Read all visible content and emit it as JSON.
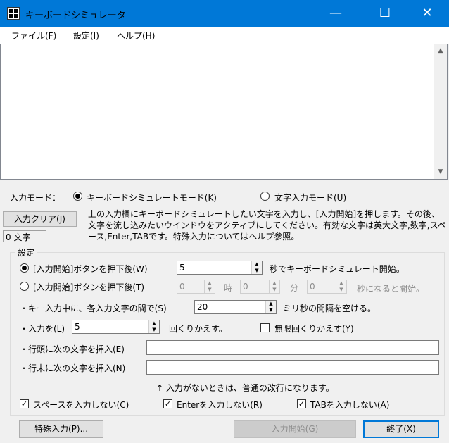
{
  "window": {
    "title": "キーボードシミュレータ"
  },
  "titlebar_buttons": {
    "minimize": "—",
    "maximize": "☐",
    "close": "✕"
  },
  "menu": [
    "ファイル(F)",
    "設定(I)",
    "ヘルプ(H)"
  ],
  "input_mode": {
    "label": "入力モード：",
    "options": [
      "キーボードシミュレートモード(K)",
      "文字入力モード(U)"
    ],
    "selected": "キーボードシミュレートモード(K)"
  },
  "clear_button": "入力クリア(J)",
  "char_count": "0 文字",
  "description": "上の入力欄にキーボードシミュレートしたい文字を入力し、[入力開始]を押します。その後、文字を流し込みたいウインドウをアクティブにしてください。有効な文字は英大文字,数字,スペース,Enter,TABです。特殊入力についてはヘルプ参照。",
  "settings": {
    "group_label": "設定",
    "start_after": {
      "label": "[入力開始]ボタンを押下後(W)",
      "value": "5",
      "suffix": "秒でキーボードシミュレート開始。",
      "selected": true
    },
    "start_at": {
      "label": "[入力開始]ボタンを押下後(T)",
      "hour": "0",
      "hour_unit": "時",
      "minute": "0",
      "minute_unit": "分",
      "second": "0",
      "suffix": "秒になると開始。",
      "selected": false
    },
    "interval": {
      "label": "・キー入力中に、各入力文字の間で(S)",
      "value": "20",
      "suffix": "ミリ秒の間隔を空ける。"
    },
    "repeat": {
      "label": "・入力を(L)",
      "value": "5",
      "suffix": "回くりかえす。",
      "infinite_label": "無限回くりかえす(Y)",
      "infinite_checked": false
    },
    "line_head": {
      "label": "・行頭に次の文字を挿入(E)",
      "value": ""
    },
    "line_tail": {
      "label": "・行末に次の文字を挿入(N)",
      "value": ""
    },
    "note": "↑ 入力がないときは、普通の改行になります。",
    "no_space": {
      "label": "スペースを入力しない(C)",
      "checked": true
    },
    "no_enter": {
      "label": "Enterを入力しない(R)",
      "checked": true
    },
    "no_tab": {
      "label": "TABを入力しない(A)",
      "checked": true
    }
  },
  "buttons": {
    "special": "特殊入力(P)...",
    "start": "入力開始(G)",
    "exit": "終了(X)"
  },
  "icons": {
    "check": "✓",
    "up": "▲",
    "down": "▼"
  }
}
